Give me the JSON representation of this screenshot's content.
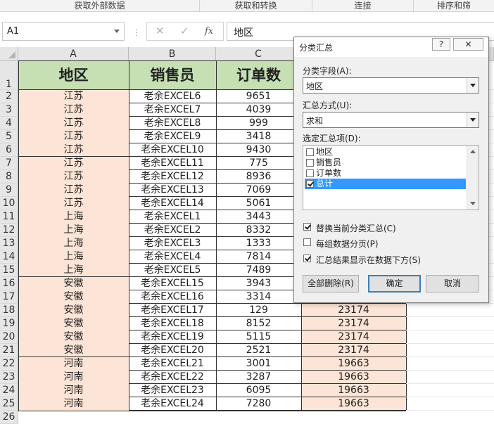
{
  "ribbon": {
    "groups": [
      "获取外部数据",
      "获取和转换",
      "连接",
      "排序和筛"
    ]
  },
  "formula_bar": {
    "name_box": "A1",
    "cancel_glyph": "✕",
    "enter_glyph": "✓",
    "fx_glyph": "fx",
    "content": "地区"
  },
  "sheet": {
    "columns": [
      "A",
      "B",
      "C"
    ],
    "rows": [
      "1",
      "2",
      "3",
      "4",
      "5",
      "6",
      "7",
      "8",
      "9",
      "10",
      "11",
      "12",
      "13",
      "14",
      "15",
      "16",
      "17",
      "18",
      "19",
      "20",
      "21",
      "22",
      "23",
      "24",
      "25",
      "26"
    ],
    "headers": [
      "地区",
      "销售员",
      "订单数"
    ],
    "data": [
      [
        "江苏",
        "老余EXCEL6",
        "9651",
        ""
      ],
      [
        "江苏",
        "老余EXCEL7",
        "4039",
        ""
      ],
      [
        "江苏",
        "老余EXCEL8",
        "999",
        ""
      ],
      [
        "江苏",
        "老余EXCEL9",
        "3418",
        ""
      ],
      [
        "江苏",
        "老余EXCEL10",
        "9430",
        ""
      ],
      [
        "江苏",
        "老余EXCEL11",
        "775",
        ""
      ],
      [
        "江苏",
        "老余EXCEL12",
        "8936",
        ""
      ],
      [
        "江苏",
        "老余EXCEL13",
        "7069",
        ""
      ],
      [
        "江苏",
        "老余EXCEL14",
        "5061",
        ""
      ],
      [
        "上海",
        "老余EXCEL1",
        "3443",
        ""
      ],
      [
        "上海",
        "老余EXCEL2",
        "8332",
        ""
      ],
      [
        "上海",
        "老余EXCEL3",
        "1333",
        ""
      ],
      [
        "上海",
        "老余EXCEL4",
        "7814",
        ""
      ],
      [
        "上海",
        "老余EXCEL5",
        "7489",
        ""
      ],
      [
        "安徽",
        "老余EXCEL15",
        "3943",
        ""
      ],
      [
        "安徽",
        "老余EXCEL16",
        "3314",
        ""
      ],
      [
        "安徽",
        "老余EXCEL17",
        "129",
        "23174"
      ],
      [
        "安徽",
        "老余EXCEL18",
        "8152",
        "23174"
      ],
      [
        "安徽",
        "老余EXCEL19",
        "5115",
        "23174"
      ],
      [
        "安徽",
        "老余EXCEL20",
        "2521",
        "23174"
      ],
      [
        "河南",
        "老余EXCEL21",
        "3001",
        "19663"
      ],
      [
        "河南",
        "老余EXCEL22",
        "3287",
        "19663"
      ],
      [
        "河南",
        "老余EXCEL23",
        "6095",
        "19663"
      ],
      [
        "河南",
        "老余EXCEL24",
        "7280",
        "19663"
      ]
    ]
  },
  "dialog": {
    "title": "分类汇总",
    "help_glyph": "?",
    "close_glyph": "✕",
    "group_by_label": "分类字段(A):",
    "group_by_value": "地区",
    "function_label": "汇总方式(U):",
    "function_value": "求和",
    "items_label": "选定汇总项(D):",
    "items": [
      {
        "label": "地区",
        "checked": false
      },
      {
        "label": "销售员",
        "checked": false
      },
      {
        "label": "订单数",
        "checked": false
      },
      {
        "label": "总计",
        "checked": true
      }
    ],
    "options": [
      {
        "label": "替换当前分类汇总(C)",
        "checked": true
      },
      {
        "label": "每组数据分页(P)",
        "checked": false
      },
      {
        "label": "汇总结果显示在数据下方(S)",
        "checked": true
      }
    ],
    "remove_all_label": "全部删除(R)",
    "ok_label": "确定",
    "cancel_label": "取消"
  },
  "colors": {
    "header_green": "#c6e0b4",
    "cell_pink": "#fce4d6",
    "selection_blue": "#3399ff"
  }
}
